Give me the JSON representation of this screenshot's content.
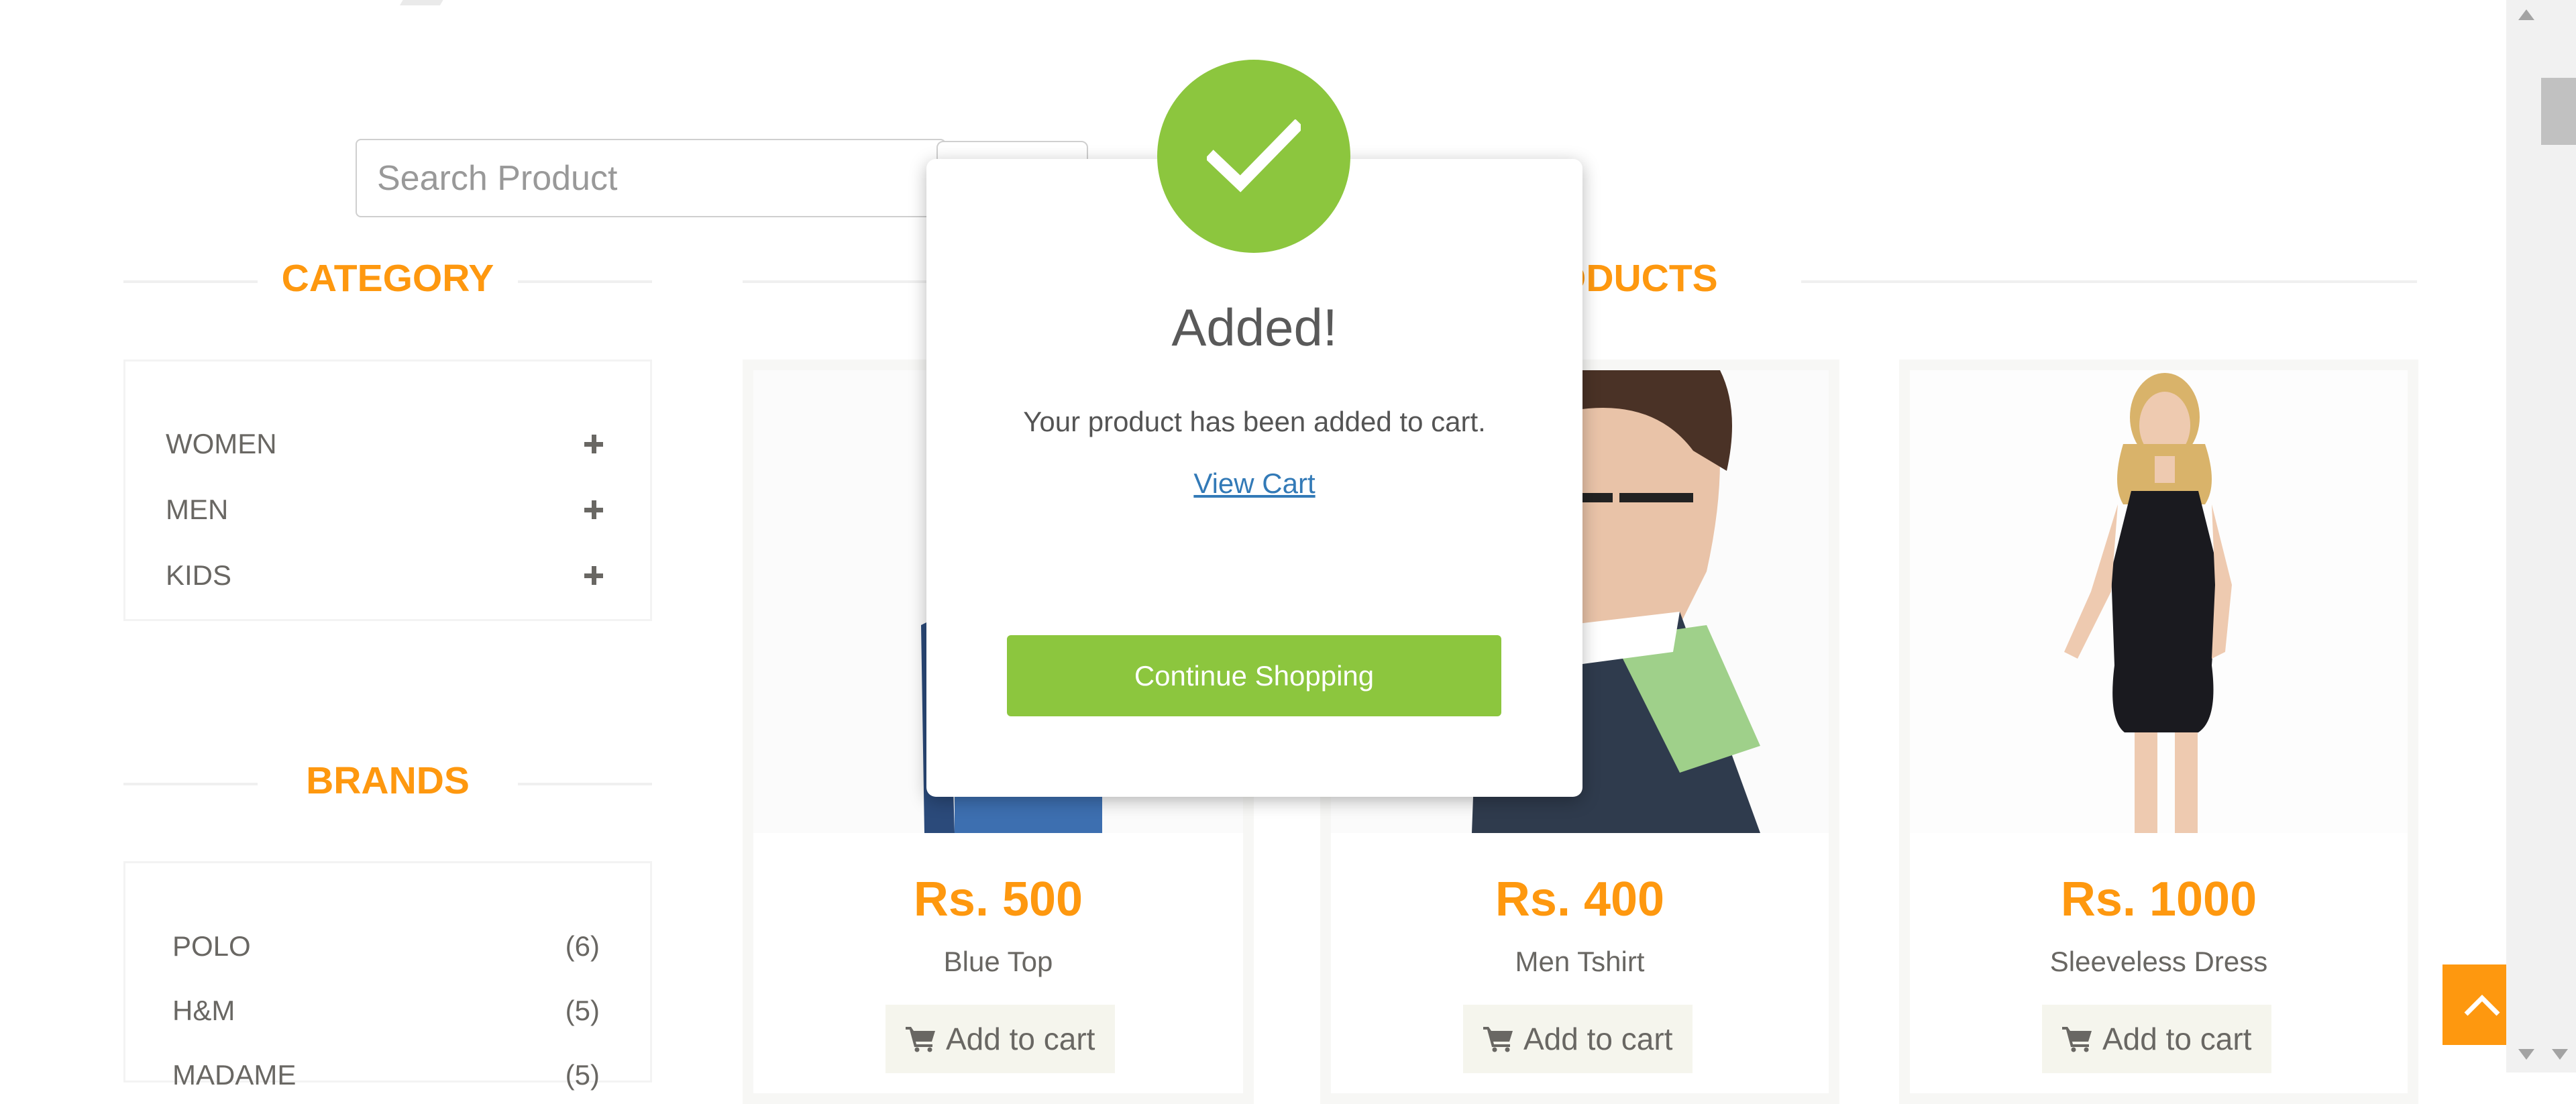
{
  "search": {
    "placeholder": "Search Product"
  },
  "sidebar": {
    "category_title": "CATEGORY",
    "categories": [
      {
        "label": "WOMEN"
      },
      {
        "label": "MEN"
      },
      {
        "label": "KIDS"
      }
    ],
    "brands_title": "BRANDS",
    "brands": [
      {
        "label": "POLO",
        "count": "(6)"
      },
      {
        "label": "H&M",
        "count": "(5)"
      },
      {
        "label": "MADAME",
        "count": "(5)"
      }
    ]
  },
  "main": {
    "section_title_fragment": "ODUCTS",
    "products": [
      {
        "price": "Rs. 500",
        "name": "Blue Top",
        "add_label": "Add to cart"
      },
      {
        "price": "Rs. 400",
        "name": "Men Tshirt",
        "add_label": "Add to cart"
      },
      {
        "price": "Rs. 1000",
        "name": "Sleeveless Dress",
        "add_label": "Add to cart"
      }
    ]
  },
  "modal": {
    "title": "Added!",
    "message": "Your product has been added to cart.",
    "view_cart_label": "View Cart",
    "continue_label": "Continue Shopping"
  },
  "colors": {
    "accent": "#FE980F",
    "success": "#8CC63E",
    "link": "#337ab7"
  }
}
